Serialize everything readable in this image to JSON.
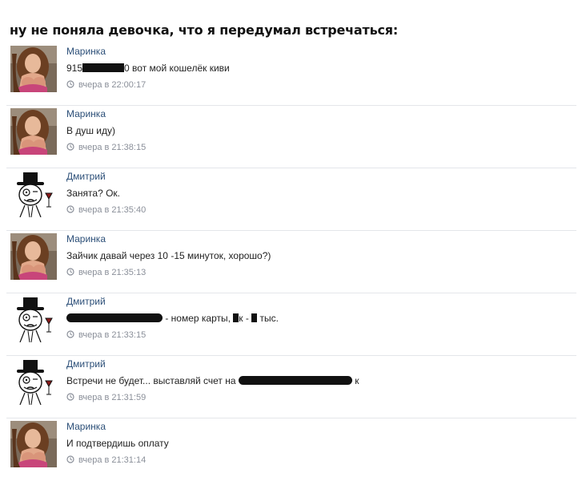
{
  "caption": "ну не поняла девочка, что я передумал встречаться:",
  "icons": {
    "clock": "clock-icon",
    "avatar_marinka": "photo-avatar",
    "avatar_dmitry": "like-a-sir-meme-avatar"
  },
  "messages": [
    {
      "author": "Маринка",
      "text_a": "915",
      "text_b": "0 вот мой кошелёк киви",
      "time": "вчера в 22:00:17"
    },
    {
      "author": "Маринка",
      "text": "В душ иду)",
      "time": "вчера в 21:38:15"
    },
    {
      "author": "Дмитрий",
      "text": "Занята? Ок.",
      "time": "вчера в 21:35:40"
    },
    {
      "author": "Маринка",
      "text": "Зайчик давай через 10 -15 минуток, хорошо?)",
      "time": "вчера в 21:35:13"
    },
    {
      "author": "Дмитрий",
      "text_a": " - номер карты, ",
      "text_b": "к - ",
      "text_c": " тыс.",
      "time": "вчера в 21:33:15"
    },
    {
      "author": "Дмитрий",
      "text_a": "Встречи не будет... выставляй счет на ",
      "text_b": " к",
      "time": "вчера в 21:31:59"
    },
    {
      "author": "Маринка",
      "text": "И подтвердишь оплату",
      "time": "вчера в 21:31:14"
    }
  ]
}
